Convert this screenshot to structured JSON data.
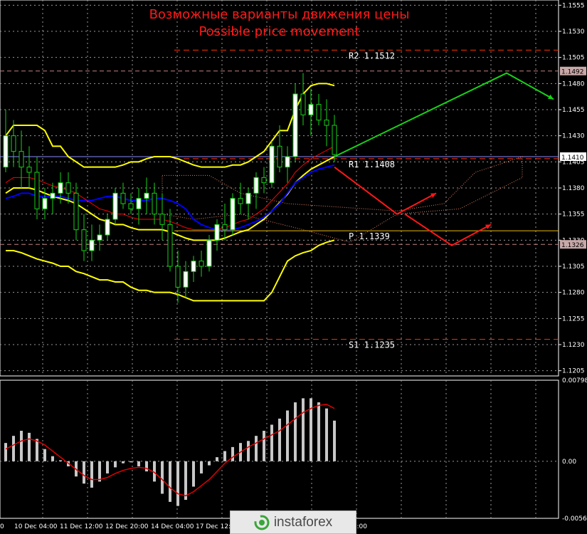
{
  "titles": {
    "ru": "Возможные варианты движения цены",
    "en": "Possible price movement"
  },
  "colors": {
    "grid": "#9a9a9a",
    "text": "#ffffff",
    "title": "#ff1a1a",
    "up": "#17d117",
    "down": "#ff1717",
    "bollinger": "#ffff00",
    "envelope": "#ff0000",
    "ma": "#0000ff",
    "levels": "#ff3300"
  },
  "levels": [
    {
      "label": "R2  1.1512",
      "value": 1.1512
    },
    {
      "label": "R1  1.1408",
      "value": 1.1408
    },
    {
      "label": "P  1.1339",
      "value": 1.1339
    },
    {
      "label": "S1  1.1235",
      "value": 1.1235
    }
  ],
  "price_markers": [
    {
      "label": "1.1492",
      "value": 1.1492
    },
    {
      "label": "1.1410",
      "value": 1.141
    },
    {
      "label": "1.1326",
      "value": 1.1326
    }
  ],
  "x_ticks": [
    "0",
    "10 Dec 04:00",
    "11 Dec 12:00",
    "12 Dec 20:00",
    "14 Dec 04:00",
    "17 Dec 12:00",
    "12:00"
  ],
  "logo_text": "instaforex",
  "chart_data": [
    {
      "type": "candlestick",
      "title": "",
      "y_ticks": [
        "1.1555",
        "1.1530",
        "1.1505",
        "1.1480",
        "1.1455",
        "1.1430",
        "1.1405",
        "1.1380",
        "1.1355",
        "1.1330",
        "1.1305",
        "1.1280",
        "1.1255",
        "1.1230",
        "1.1205"
      ],
      "ylim": [
        1.12,
        1.156
      ],
      "candles": [
        [
          1.14,
          1.1455,
          1.1395,
          1.143
        ],
        [
          1.143,
          1.1445,
          1.14,
          1.1415
        ],
        [
          1.1415,
          1.1435,
          1.138,
          1.14
        ],
        [
          1.14,
          1.142,
          1.138,
          1.1395
        ],
        [
          1.1395,
          1.141,
          1.135,
          1.136
        ],
        [
          1.136,
          1.138,
          1.135,
          1.137
        ],
        [
          1.137,
          1.1385,
          1.1355,
          1.1375
        ],
        [
          1.1375,
          1.1395,
          1.1365,
          1.1385
        ],
        [
          1.1385,
          1.1395,
          1.1365,
          1.1375
        ],
        [
          1.1375,
          1.1385,
          1.133,
          1.134
        ],
        [
          1.134,
          1.1355,
          1.131,
          1.132
        ],
        [
          1.132,
          1.1345,
          1.131,
          1.133
        ],
        [
          1.133,
          1.1345,
          1.132,
          1.1335
        ],
        [
          1.1335,
          1.1355,
          1.133,
          1.135
        ],
        [
          1.135,
          1.138,
          1.1345,
          1.1375
        ],
        [
          1.1375,
          1.1385,
          1.136,
          1.1365
        ],
        [
          1.1365,
          1.1375,
          1.1355,
          1.136
        ],
        [
          1.136,
          1.138,
          1.1345,
          1.137
        ],
        [
          1.137,
          1.139,
          1.1355,
          1.1375
        ],
        [
          1.1375,
          1.1385,
          1.1345,
          1.1355
        ],
        [
          1.1355,
          1.1375,
          1.133,
          1.1345
        ],
        [
          1.1345,
          1.136,
          1.13,
          1.1305
        ],
        [
          1.1305,
          1.132,
          1.127,
          1.1285
        ],
        [
          1.1285,
          1.131,
          1.1275,
          1.13
        ],
        [
          1.13,
          1.1315,
          1.129,
          1.131
        ],
        [
          1.131,
          1.132,
          1.1295,
          1.1305
        ],
        [
          1.1305,
          1.1335,
          1.13,
          1.133
        ],
        [
          1.133,
          1.135,
          1.132,
          1.1345
        ],
        [
          1.1345,
          1.1365,
          1.133,
          1.134
        ],
        [
          1.134,
          1.1375,
          1.1335,
          1.137
        ],
        [
          1.137,
          1.1385,
          1.1355,
          1.1365
        ],
        [
          1.1365,
          1.138,
          1.135,
          1.1375
        ],
        [
          1.1375,
          1.1395,
          1.136,
          1.139
        ],
        [
          1.139,
          1.14,
          1.1375,
          1.1385
        ],
        [
          1.1385,
          1.1425,
          1.138,
          1.142
        ],
        [
          1.142,
          1.144,
          1.1395,
          1.14
        ],
        [
          1.14,
          1.142,
          1.1385,
          1.141
        ],
        [
          1.141,
          1.148,
          1.1405,
          1.147
        ],
        [
          1.147,
          1.149,
          1.144,
          1.145
        ],
        [
          1.145,
          1.1475,
          1.143,
          1.146
        ],
        [
          1.146,
          1.147,
          1.144,
          1.1445
        ],
        [
          1.1445,
          1.1465,
          1.142,
          1.144
        ],
        [
          1.144,
          1.145,
          1.1405,
          1.1412
        ]
      ],
      "bollinger_upper": [
        1.143,
        1.144,
        1.144,
        1.144,
        1.144,
        1.1435,
        1.142,
        1.142,
        1.141,
        1.1405,
        1.14,
        1.14,
        1.14,
        1.14,
        1.14,
        1.1402,
        1.1405,
        1.1405,
        1.1408,
        1.141,
        1.141,
        1.141,
        1.1408,
        1.1405,
        1.1402,
        1.14,
        1.14,
        1.14,
        1.14,
        1.1402,
        1.1402,
        1.1405,
        1.141,
        1.1415,
        1.1425,
        1.1435,
        1.1435,
        1.1455,
        1.147,
        1.1478,
        1.148,
        1.148,
        1.1478
      ],
      "bollinger_middle": [
        1.1375,
        1.138,
        1.138,
        1.138,
        1.1378,
        1.1375,
        1.1372,
        1.137,
        1.1368,
        1.1365,
        1.136,
        1.1355,
        1.135,
        1.1348,
        1.1345,
        1.1345,
        1.1342,
        1.134,
        1.134,
        1.134,
        1.134,
        1.1338,
        1.1335,
        1.1332,
        1.133,
        1.133,
        1.133,
        1.133,
        1.1332,
        1.1335,
        1.1338,
        1.134,
        1.1345,
        1.135,
        1.1358,
        1.1366,
        1.1374,
        1.1385,
        1.1392,
        1.1398,
        1.1402,
        1.1406,
        1.141
      ],
      "bollinger_lower": [
        1.132,
        1.132,
        1.1318,
        1.1315,
        1.1312,
        1.131,
        1.1308,
        1.1305,
        1.1305,
        1.13,
        1.1298,
        1.1295,
        1.1292,
        1.1292,
        1.129,
        1.129,
        1.1285,
        1.1282,
        1.1282,
        1.128,
        1.128,
        1.128,
        1.1278,
        1.1275,
        1.1272,
        1.1272,
        1.1272,
        1.1272,
        1.1272,
        1.1272,
        1.1272,
        1.1272,
        1.1272,
        1.1272,
        1.128,
        1.1295,
        1.131,
        1.1315,
        1.1318,
        1.132,
        1.1325,
        1.1328,
        1.133
      ],
      "ma": [
        1.137,
        1.1372,
        1.1375,
        1.1375,
        1.1372,
        1.1372,
        1.1372,
        1.1372,
        1.137,
        1.1368,
        1.1368,
        1.1368,
        1.137,
        1.1372,
        1.1372,
        1.137,
        1.1368,
        1.1368,
        1.1368,
        1.137,
        1.137,
        1.1368,
        1.1365,
        1.136,
        1.135,
        1.1345,
        1.1342,
        1.134,
        1.134,
        1.134,
        1.1342,
        1.1345,
        1.1348,
        1.1352,
        1.1358,
        1.1365,
        1.1375,
        1.1385,
        1.139,
        1.1395,
        1.1398,
        1.14,
        1.1402
      ],
      "forecast_paths": [
        {
          "color": "up",
          "points": [
            [
              42,
              1.141
            ],
            [
              64,
              1.149
            ],
            [
              70,
              1.1465
            ]
          ]
        },
        {
          "color": "down",
          "points": [
            [
              42,
              1.14
            ],
            [
              50,
              1.1355
            ],
            [
              55,
              1.1375
            ]
          ]
        },
        {
          "color": "down",
          "points": [
            [
              51,
              1.1355
            ],
            [
              57,
              1.1325
            ],
            [
              62,
              1.1345
            ]
          ]
        }
      ]
    },
    {
      "type": "bar",
      "title": "",
      "y_ticks": [
        "0.00798",
        "0.00",
        "-0.00562"
      ],
      "ylim": [
        -0.00562,
        0.00798
      ],
      "values": [
        0.0018,
        0.0025,
        0.003,
        0.0028,
        0.0022,
        0.0012,
        0.0005,
        0.0001,
        -0.0005,
        -0.0015,
        -0.0022,
        -0.0026,
        -0.002,
        -0.0012,
        -0.0006,
        -0.0002,
        -0.0001,
        -0.0005,
        -0.001,
        -0.002,
        -0.0032,
        -0.004,
        -0.0044,
        -0.0038,
        -0.0025,
        -0.0012,
        -0.0004,
        0.0004,
        0.001,
        0.0014,
        0.0018,
        0.002,
        0.0025,
        0.003,
        0.0036,
        0.0042,
        0.005,
        0.0058,
        0.0062,
        0.0062,
        0.0058,
        0.0052,
        0.004
      ],
      "signal": [
        0.0012,
        0.0016,
        0.002,
        0.0022,
        0.002,
        0.0016,
        0.001,
        0.0004,
        -0.0002,
        -0.0008,
        -0.0014,
        -0.0018,
        -0.0018,
        -0.0016,
        -0.0012,
        -0.0009,
        -0.0007,
        -0.0006,
        -0.0007,
        -0.0011,
        -0.0018,
        -0.0026,
        -0.0032,
        -0.0034,
        -0.003,
        -0.0024,
        -0.0018,
        -0.001,
        -0.0002,
        0.0004,
        0.0009,
        0.0014,
        0.0018,
        0.0022,
        0.0026,
        0.003,
        0.0036,
        0.0042,
        0.0048,
        0.0052,
        0.0055,
        0.0056,
        0.0052
      ]
    }
  ]
}
